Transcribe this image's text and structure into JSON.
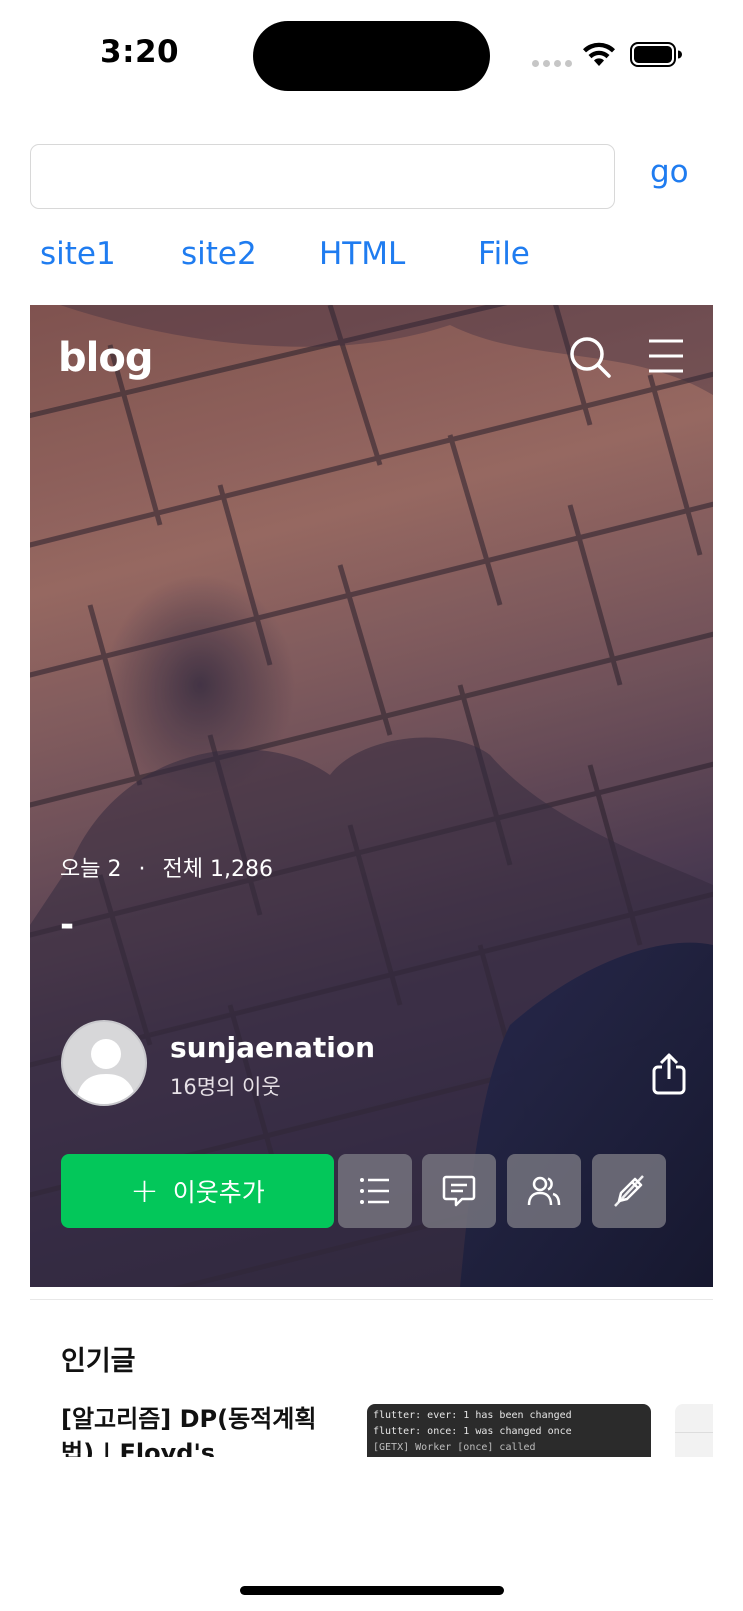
{
  "status_bar": {
    "time": "3:20"
  },
  "browser": {
    "url_input": {
      "value": "",
      "placeholder": ""
    },
    "go_label": "go",
    "quick_links": [
      "site1",
      "site2",
      "HTML",
      "File"
    ]
  },
  "blog": {
    "logo": "blog",
    "visits": {
      "today_label": "오늘",
      "today_count": "2",
      "total_label": "전체",
      "total_count": "1,286"
    },
    "title": "-",
    "profile": {
      "nickname": "sunjaenation",
      "neighbors": "16명의 이웃"
    },
    "add_neighbor_label": "이웃추가",
    "action_icons": [
      "list-icon",
      "comment-icon",
      "neighbors-icon",
      "edit-icon"
    ],
    "popular_section_title": "인기글",
    "popular_posts": [
      {
        "title": "[알고리즘] DP(동적계획법) | Floyd's Algorithm",
        "thumbnail_lines": [
          "flutter: ever: 1 has been changed",
          "flutter: once: 1 was changed once",
          "[GETX] Worker [once] called"
        ]
      }
    ]
  },
  "colors": {
    "accent": "#1f7cf0",
    "naver_green": "#03c75a"
  }
}
